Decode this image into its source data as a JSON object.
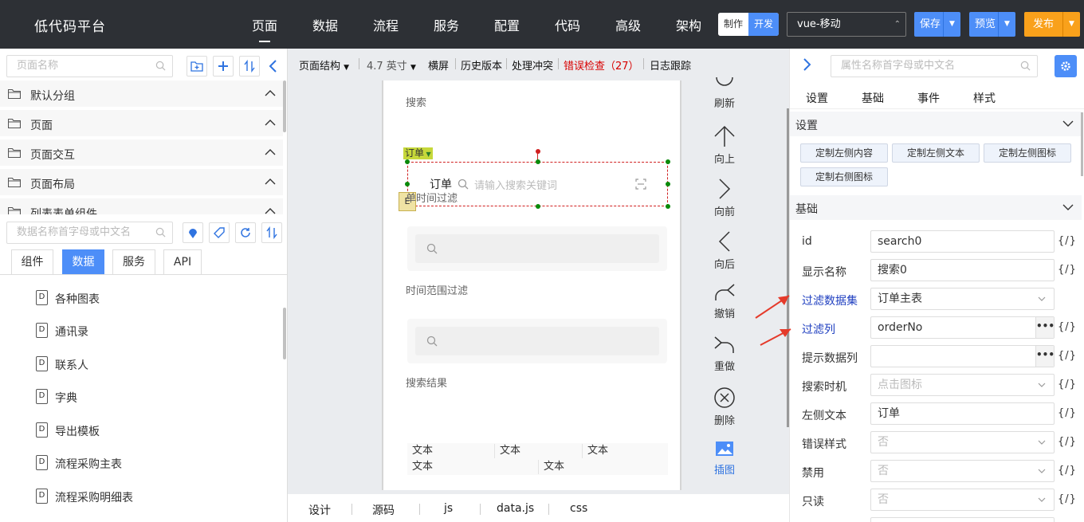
{
  "topbar": {
    "brand": "低代码平台",
    "nav": [
      "页面",
      "数据",
      "流程",
      "服务",
      "配置",
      "代码",
      "高级",
      "架构"
    ],
    "mode_make": "制作",
    "mode_dev": "开发",
    "device": "vue-移动",
    "save": "保存",
    "preview": "预览",
    "publish": "发布"
  },
  "left": {
    "page_search_placeholder": "页面名称",
    "groups": [
      "默认分组",
      "页面",
      "页面交互",
      "页面布局",
      "列表表单组件"
    ],
    "data_search_placeholder": "数据名称首字母或中文名",
    "tabs": [
      "组件",
      "数据",
      "服务",
      "API"
    ],
    "datasets": [
      "各种图表",
      "通讯录",
      "联系人",
      "字典",
      "导出模板",
      "流程采购主表",
      "流程采购明细表"
    ]
  },
  "canvas": {
    "toolbar": {
      "page_structure": "页面结构",
      "screen_size": "4.7 英寸",
      "landscape": "横屏",
      "history": "历史版本",
      "conflicts": "处理冲突",
      "error_check": "错误检查（27）",
      "log_trace": "日志跟踪"
    },
    "phone": {
      "section_search": "搜索",
      "tag": "订单",
      "search_left_text": "订单",
      "search_placeholder": "请输入搜索关键词",
      "section_single_time": "单时间过滤",
      "section_time_range": "时间范围过滤",
      "section_results": "搜索结果",
      "cell_text": "文本",
      "mini_icon_text": "E"
    },
    "tools": [
      "刷新",
      "向上",
      "向前",
      "向后",
      "撤销",
      "重做",
      "删除",
      "插图"
    ],
    "bottom_tabs": [
      "设计",
      "源码",
      "js",
      "data.js",
      "css"
    ]
  },
  "right": {
    "search_placeholder": "属性名称首字母或中文名",
    "tabs": [
      "设置",
      "基础",
      "事件",
      "样式"
    ],
    "section_settings": "设置",
    "custom_buttons": [
      "定制左侧内容",
      "定制左侧文本",
      "定制左侧图标",
      "定制右侧图标"
    ],
    "section_basic": "基础",
    "fx": "{/}",
    "props": [
      {
        "label": "id",
        "value": "search0"
      },
      {
        "label": "显示名称",
        "value": "搜索0"
      },
      {
        "label": "过滤数据集",
        "value": "订单主表"
      },
      {
        "label": "过滤列",
        "value": "orderNo"
      },
      {
        "label": "提示数据列",
        "value": ""
      },
      {
        "label": "搜索时机",
        "value": "点击图标"
      },
      {
        "label": "左侧文本",
        "value": "订单"
      },
      {
        "label": "错误样式",
        "value": "否"
      },
      {
        "label": "禁用",
        "value": "否"
      },
      {
        "label": "只读",
        "value": "否"
      }
    ]
  },
  "colors": {
    "accent": "#4d8ef8",
    "publish": "#f9a11b",
    "topbar": "#2d3035",
    "error": "#d80000",
    "annotation": "#e53a2a"
  }
}
